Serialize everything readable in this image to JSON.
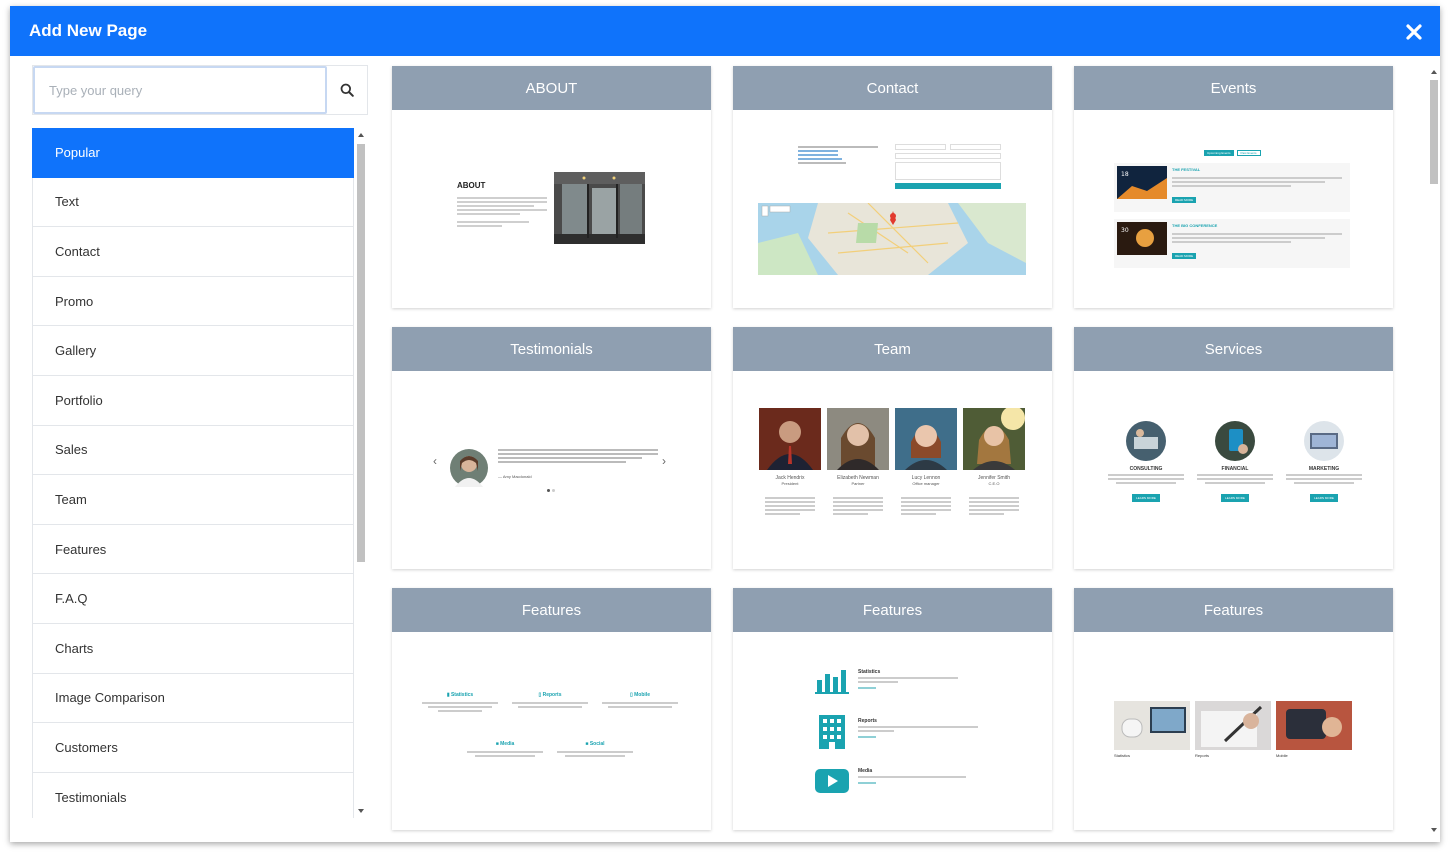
{
  "dialog": {
    "title": "Add New Page",
    "close_icon": "close-icon"
  },
  "search": {
    "placeholder": "Type your query",
    "icon": "search-icon"
  },
  "categories": [
    {
      "label": "Popular",
      "active": true
    },
    {
      "label": "Text"
    },
    {
      "label": "Contact"
    },
    {
      "label": "Promo"
    },
    {
      "label": "Gallery"
    },
    {
      "label": "Portfolio"
    },
    {
      "label": "Sales"
    },
    {
      "label": "Team"
    },
    {
      "label": "Features"
    },
    {
      "label": "F.A.Q"
    },
    {
      "label": "Charts"
    },
    {
      "label": "Image Comparison"
    },
    {
      "label": "Customers"
    },
    {
      "label": "Testimonials"
    }
  ],
  "templates": [
    {
      "title": "ABOUT"
    },
    {
      "title": "Contact"
    },
    {
      "title": "Events"
    },
    {
      "title": "Testimonials"
    },
    {
      "title": "Team"
    },
    {
      "title": "Services"
    },
    {
      "title": "Features"
    },
    {
      "title": "Features"
    },
    {
      "title": "Features"
    }
  ],
  "previews": {
    "about": {
      "heading": "ABOUT"
    },
    "events": {
      "tab1": "Upcoming Events",
      "tab2": "Past Events",
      "event1": "THE FESTIVAL",
      "event2": "THE BIG CONFERENCE",
      "btn": "READ MORE"
    },
    "testimonial": {
      "author": "— Amy Macdonald"
    },
    "team": {
      "members": [
        {
          "name": "Jack Hendrix",
          "role": "President"
        },
        {
          "name": "Elizabeth Newman",
          "role": "Partner"
        },
        {
          "name": "Lucy Lennon",
          "role": "Office manager"
        },
        {
          "name": "Jennifer Smith",
          "role": "C.E.O"
        }
      ]
    },
    "services": {
      "items": [
        {
          "name": "CONSULTING",
          "btn": "LEARN MORE"
        },
        {
          "name": "FINANCIAL",
          "btn": "LEARN MORE"
        },
        {
          "name": "MARKETING",
          "btn": "LEARN MORE"
        }
      ]
    },
    "features1": {
      "items": [
        "Statistics",
        "Reports",
        "Mobile",
        "Media",
        "Social"
      ]
    },
    "features2": {
      "items": [
        "Statistics",
        "Reports",
        "Media"
      ]
    },
    "features3": {
      "items": [
        "Statistics",
        "Reports",
        "Mobile"
      ]
    }
  },
  "colors": {
    "accent": "#0f73fb",
    "card_header": "#8f9fb1",
    "teal": "#1aa3b0"
  }
}
